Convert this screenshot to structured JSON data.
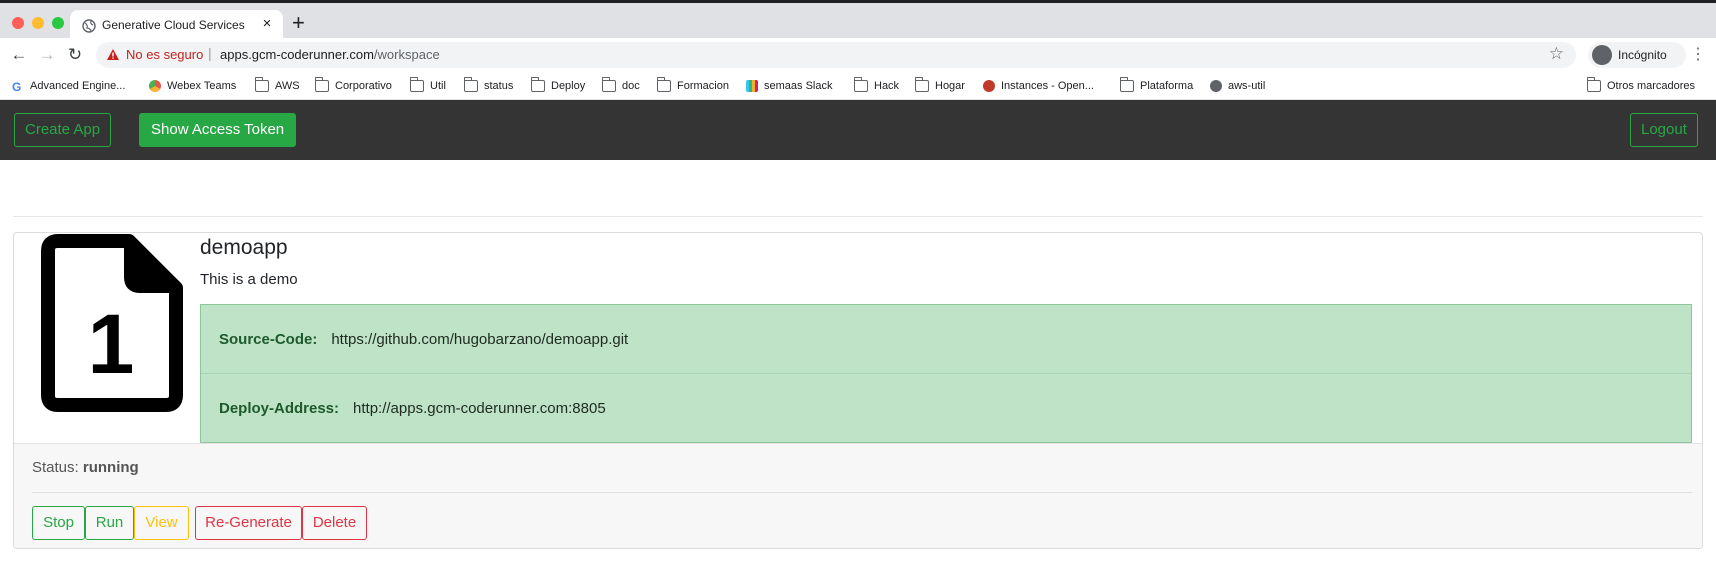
{
  "browser": {
    "tab_title": "Generative Cloud Services",
    "tab_close": "×",
    "new_tab": "+",
    "not_secure": "No es seguro",
    "url_host": "apps.gcm-coderunner.com",
    "url_path": "/workspace",
    "profile_label": "Incógnito",
    "star_glyph": "☆",
    "menu_glyph": "⋮",
    "nav": {
      "back": "←",
      "forward": "→",
      "reload": "↻"
    }
  },
  "bookmarks": [
    {
      "label": "Advanced Engine...",
      "icon": "google-icon",
      "color": "#4285f4"
    },
    {
      "label": "Webex Teams",
      "icon": "webex-icon",
      "color": "#e2574c"
    },
    {
      "label": "AWS",
      "icon": "folder-icon"
    },
    {
      "label": "Corporativo",
      "icon": "folder-icon"
    },
    {
      "label": "Util",
      "icon": "folder-icon"
    },
    {
      "label": "status",
      "icon": "folder-icon"
    },
    {
      "label": "Deploy",
      "icon": "folder-icon"
    },
    {
      "label": "doc",
      "icon": "folder-icon"
    },
    {
      "label": "Formacion",
      "icon": "folder-icon"
    },
    {
      "label": "semaas Slack",
      "icon": "slack-icon",
      "color": "#36c5f0"
    },
    {
      "label": "Hack",
      "icon": "folder-icon"
    },
    {
      "label": "Hogar",
      "icon": "folder-icon"
    },
    {
      "label": "Instances - Open...",
      "icon": "openstack-icon",
      "color": "#c0392b"
    },
    {
      "label": "Plataforma",
      "icon": "folder-icon"
    },
    {
      "label": "aws-util",
      "icon": "globe-icon",
      "color": "#5f6368"
    },
    {
      "label": "Otros marcadores",
      "icon": "folder-icon"
    }
  ],
  "navbar": {
    "create_app": "Create App",
    "show_token": "Show Access Token",
    "logout": "Logout"
  },
  "app": {
    "icon_digit": "1",
    "name": "demoapp",
    "description": "This is a demo",
    "source_label": "Source-Code:",
    "source_value": "https://github.com/hugobarzano/demoapp.git",
    "deploy_label": "Deploy-Address:",
    "deploy_value": "http://apps.gcm-coderunner.com:8805",
    "status_label": "Status:",
    "status_value": "running"
  },
  "actions": {
    "stop": "Stop",
    "run": "Run",
    "view": "View",
    "regenerate": "Re-Generate",
    "delete": "Delete"
  },
  "colors": {
    "success": "#28a745",
    "warning": "#ffc107",
    "danger": "#dc3545",
    "navbar_bg": "#343434",
    "info_bg": "#bfe3c6"
  }
}
